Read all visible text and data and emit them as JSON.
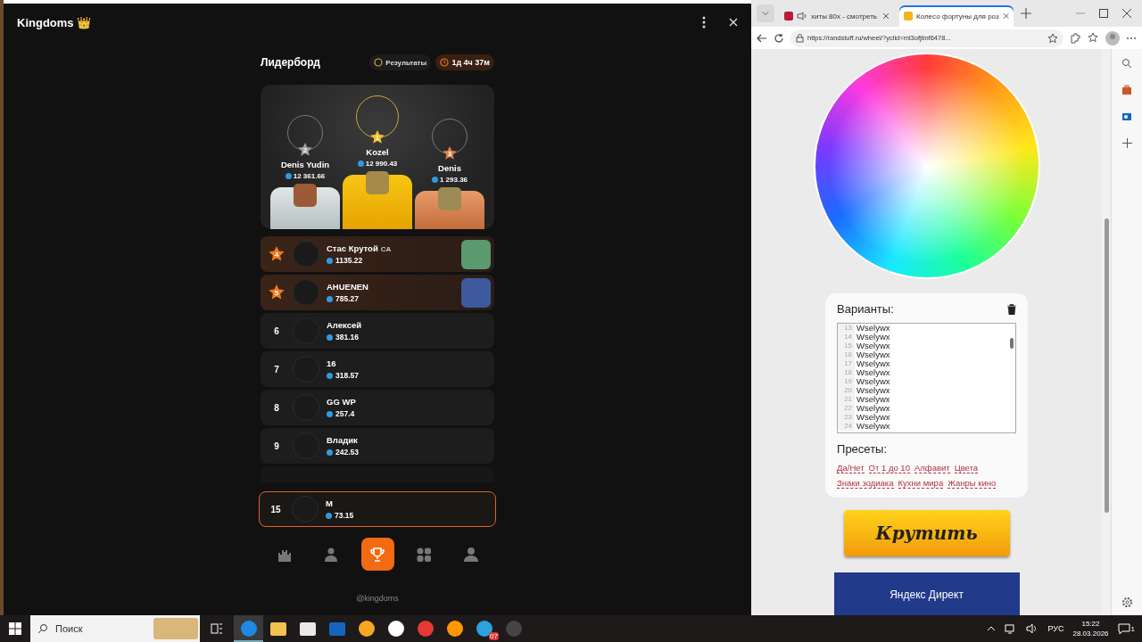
{
  "app": {
    "title": "Kingdoms 👑",
    "heading": "Лидерборд",
    "results_button": "Результаты",
    "timer": "1д 4ч 37м",
    "podium": [
      {
        "place": "2",
        "name": "Denis Yudin",
        "score": "12 361.66"
      },
      {
        "place": "1",
        "name": "Kozel",
        "score": "12 990.43"
      },
      {
        "place": "3",
        "name": "Denis",
        "score": "1 293.36"
      }
    ],
    "rows": [
      {
        "kind": "prize",
        "rank": "4",
        "name": "Стас Крутой",
        "tag": "CA",
        "score": "1135.22"
      },
      {
        "kind": "prize",
        "rank": "5",
        "name": "AHUENEN",
        "score": "785.27"
      },
      {
        "kind": "plain",
        "rank": "6",
        "name": "Алексей",
        "score": "381.16"
      },
      {
        "kind": "plain",
        "rank": "7",
        "name": "16",
        "score": "318.57"
      },
      {
        "kind": "plain",
        "rank": "8",
        "name": "GG WP",
        "score": "257.4"
      },
      {
        "kind": "plain",
        "rank": "9",
        "name": "Владик",
        "score": "242.53"
      }
    ],
    "current_user": {
      "rank": "15",
      "name": "M",
      "score": "73.15"
    },
    "nav": [
      {
        "kind": "castle",
        "selected": false
      },
      {
        "kind": "creatures",
        "selected": false
      },
      {
        "kind": "trophy",
        "selected": true
      },
      {
        "kind": "grid",
        "selected": false
      },
      {
        "kind": "profile",
        "selected": false
      }
    ],
    "handle": "@kingdoms"
  },
  "browser": {
    "tabs": [
      {
        "title": "хиты 80х - смотреть",
        "selected": false,
        "audio": true
      },
      {
        "title": "Колесо фортуны для роз",
        "selected": true,
        "audio": false
      }
    ],
    "url": "https://randstuff.ru/wheel/?yclid=ml3ofjtinf6478...",
    "variants_label": "Варианты:",
    "variants": [
      {
        "n": "13",
        "text": "Wselywx"
      },
      {
        "n": "14",
        "text": "Wselywx"
      },
      {
        "n": "15",
        "text": "Wselywx"
      },
      {
        "n": "16",
        "text": "Wselywx"
      },
      {
        "n": "17",
        "text": "Wselywx"
      },
      {
        "n": "18",
        "text": "Wselywx"
      },
      {
        "n": "19",
        "text": "Wselywx"
      },
      {
        "n": "20",
        "text": "Wselywx"
      },
      {
        "n": "21",
        "text": "Wselywx"
      },
      {
        "n": "22",
        "text": "Wselywx"
      },
      {
        "n": "23",
        "text": "Wselywx"
      },
      {
        "n": "24",
        "text": "Wselywx"
      }
    ],
    "presets_label": "Пресеты:",
    "presets": [
      "Да/Нет",
      "От 1 до 10",
      "Алфавит",
      "Цвета",
      "Знаки зодиака",
      "Кухни мира",
      "Жанры кино"
    ],
    "spin_button": "Крутить",
    "ad": "Яндекс Директ"
  },
  "taskbar": {
    "search_placeholder": "Поиск",
    "apps": [
      {
        "kind": "edge"
      },
      {
        "kind": "folder"
      },
      {
        "kind": "store"
      },
      {
        "kind": "outlook"
      },
      {
        "kind": "ring"
      },
      {
        "kind": "yandex"
      },
      {
        "kind": "yandex-browser"
      },
      {
        "kind": "mail"
      },
      {
        "kind": "telegram",
        "badge": "07"
      },
      {
        "kind": "obs"
      }
    ],
    "language": "РУС",
    "time": "15:22",
    "date": "28.03.2026",
    "notifications": "1"
  }
}
